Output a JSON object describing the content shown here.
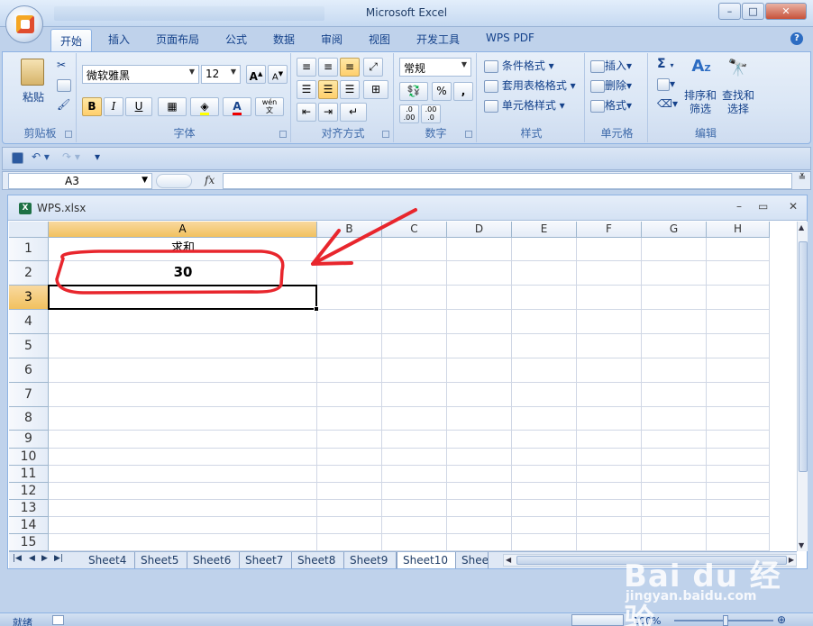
{
  "window": {
    "title": "Microsoft Excel",
    "minimize": "–",
    "maximize": "□",
    "close": "✕",
    "help": "?"
  },
  "ribbon_tabs": [
    "开始",
    "插入",
    "页面布局",
    "公式",
    "数据",
    "审阅",
    "视图",
    "开发工具",
    "WPS PDF"
  ],
  "active_tab": "开始",
  "ribbon": {
    "clipboard": {
      "label": "剪贴板",
      "paste": "粘贴"
    },
    "font": {
      "label": "字体",
      "font_name": "微软雅黑",
      "font_size": "12",
      "bold": "B",
      "italic": "I",
      "underline": "U",
      "grow": "A",
      "shrink": "A",
      "phonetic": "wén\n文"
    },
    "alignment": {
      "label": "对齐方式"
    },
    "number": {
      "label": "数字",
      "format": "常规",
      "percent": "%",
      "comma": ",",
      "inc_decimal": ".0\n.00",
      "dec_decimal": ".00\n.0"
    },
    "styles": {
      "label": "样式",
      "conditional": "条件格式",
      "table_format": "套用表格格式",
      "cell_styles": "单元格样式"
    },
    "cells": {
      "label": "单元格",
      "insert": "插入",
      "delete": "删除",
      "format": "格式"
    },
    "editing": {
      "label": "编辑",
      "sigma": "Σ",
      "sort_filter": "排序和\n筛选",
      "find_select": "查找和\n选择"
    }
  },
  "formula_bar": {
    "name_box": "A3",
    "fx": "fx",
    "formula": ""
  },
  "workbook": {
    "name": "WPS.xlsx",
    "columns": [
      "A",
      "B",
      "C",
      "D",
      "E",
      "F",
      "G",
      "H"
    ],
    "selected_column": "A",
    "rows": [
      "1",
      "2",
      "3",
      "4",
      "5",
      "6",
      "7",
      "8",
      "9",
      "10",
      "11",
      "12",
      "13",
      "14",
      "15"
    ],
    "selected_row": "3",
    "cells": {
      "A1": "求和",
      "A2": "30"
    }
  },
  "sheet_tabs": [
    "Sheet4",
    "Sheet5",
    "Sheet6",
    "Sheet7",
    "Sheet8",
    "Sheet9",
    "Sheet10",
    "Shee"
  ],
  "active_sheet": "Sheet10",
  "status": {
    "ready": "就绪",
    "zoom": "100%"
  },
  "watermark": {
    "logo": "Bai du 经验",
    "url": "jingyan.baidu.com"
  },
  "colors": {
    "annotation": "#e8262d",
    "ribbon_accent": "#15428b"
  }
}
